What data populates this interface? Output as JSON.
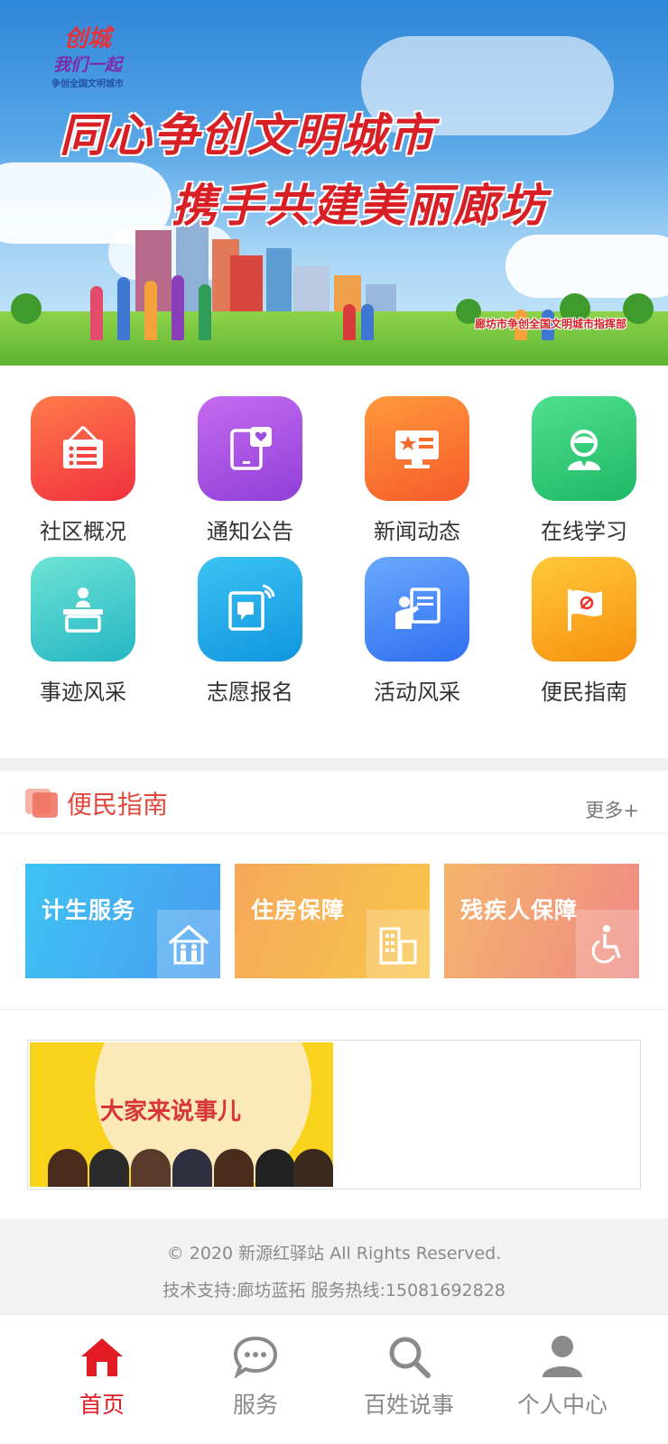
{
  "banner": {
    "logo_line1": "创城",
    "logo_line2": "我们一起",
    "logo_line3": "争创全国文明城市",
    "slogan1": "同心争创文明城市",
    "slogan2": "携手共建美丽廊坊",
    "credit": "廊坊市争创全国文明城市指挥部"
  },
  "grid": {
    "items": [
      {
        "label": "社区概况",
        "icon": "notice-board-icon",
        "color": "#f1453d"
      },
      {
        "label": "通知公告",
        "icon": "tablet-heart-icon",
        "color": "#9b4fe0"
      },
      {
        "label": "新闻动态",
        "icon": "monitor-star-icon",
        "color": "#f7692c"
      },
      {
        "label": "在线学习",
        "icon": "student-icon",
        "color": "#2ec97a"
      },
      {
        "label": "事迹风采",
        "icon": "podium-speaker-icon",
        "color": "#36c7c4"
      },
      {
        "label": "志愿报名",
        "icon": "signal-tablet-icon",
        "color": "#1ea6e8"
      },
      {
        "label": "活动风采",
        "icon": "teacher-board-icon",
        "color": "#3d84f5"
      },
      {
        "label": "便民指南",
        "icon": "party-flag-icon",
        "color": "#f8a211"
      }
    ]
  },
  "section": {
    "title": "便民指南",
    "more": "更多+"
  },
  "cards": [
    {
      "label": "计生服务",
      "icon": "family-house-icon",
      "color_from": "#3ec3f3",
      "color_to": "#4a9cf0"
    },
    {
      "label": "住房保障",
      "icon": "buildings-icon",
      "color_from": "#f6a85a",
      "color_to": "#f8c64a"
    },
    {
      "label": "残疾人保障",
      "icon": "wheelchair-icon",
      "color_from": "#f6b46b",
      "color_to": "#ee8a86"
    }
  ],
  "promo": {
    "text": "大家来说事儿"
  },
  "footer": {
    "line1": "© 2020 新源红驿站 All Rights Reserved.",
    "line2": "技术支持:廊坊蓝拓   服务热线:15081692828"
  },
  "nav": {
    "items": [
      {
        "label": "首页",
        "icon": "home-icon",
        "active": true
      },
      {
        "label": "服务",
        "icon": "chat-bubble-icon",
        "active": false
      },
      {
        "label": "百姓说事",
        "icon": "search-icon",
        "active": false
      },
      {
        "label": "个人中心",
        "icon": "user-icon",
        "active": false
      }
    ],
    "active_color": "#e21b23",
    "inactive_color": "#8a8a8a"
  }
}
